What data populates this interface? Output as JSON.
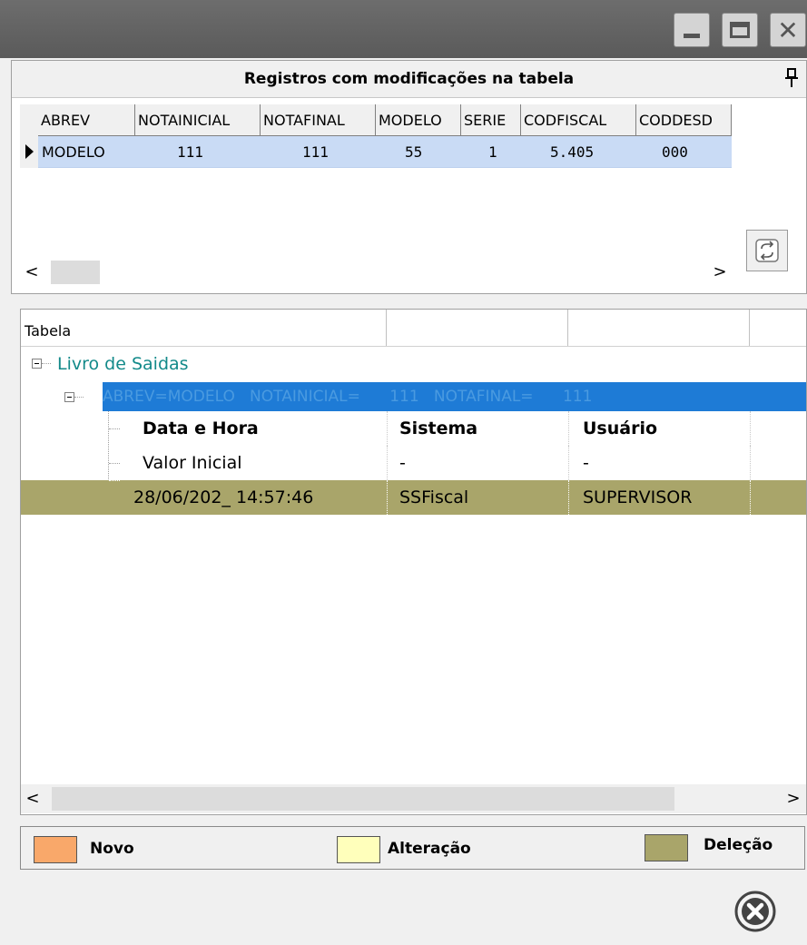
{
  "window": {
    "buttons": [
      "minimize",
      "maximize",
      "close"
    ]
  },
  "records_panel": {
    "title": "Registros com modificações na tabela",
    "columns": [
      "ABREV",
      "NOTAINICIAL",
      "NOTAFINAL",
      "MODELO",
      "SERIE",
      "CODFISCAL",
      "CODDESD"
    ],
    "row": [
      "MODELO",
      "111",
      "111",
      "55",
      "1",
      "5.405",
      "000"
    ],
    "scroll_left": "<",
    "scroll_right": ">"
  },
  "tree_panel": {
    "columns": [
      "Tabela",
      "",
      "",
      ""
    ],
    "node": "Livro de Saidas",
    "selected_record": "ABREV=MODELO   NOTAINICIAL=      111   NOTAFINAL=      111",
    "detail_header": [
      "Data e Hora",
      "Sistema",
      "Usuário"
    ],
    "detail_rows": [
      [
        "Valor Inicial",
        "-",
        "-"
      ],
      [
        "28/06/202_ 14:57:46",
        "SSFiscal",
        "SUPERVISOR"
      ]
    ],
    "scroll_left": "<",
    "scroll_right": ">"
  },
  "legend": {
    "items": [
      {
        "label": "Novo",
        "color": "#f9a86a"
      },
      {
        "label": "Alteração",
        "color": "#ffffbb"
      },
      {
        "label": "Deleção",
        "color": "#a9a56a"
      }
    ]
  },
  "colors": {
    "selection": "#1e7bd6",
    "grid_selection": "#c9dbf5",
    "tree_node": "#138a8a"
  }
}
